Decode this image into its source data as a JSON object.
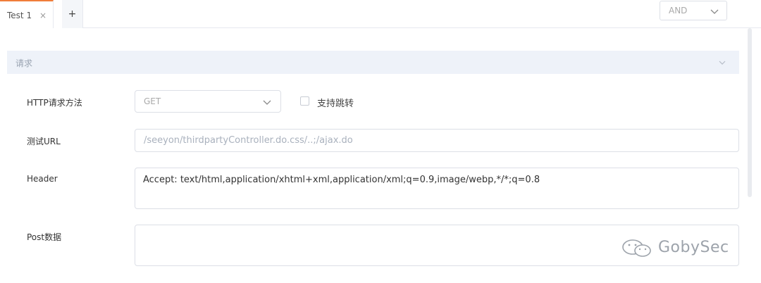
{
  "tabs": {
    "active_label": "Test 1",
    "close_glyph": "×",
    "add_glyph": "+"
  },
  "logic_select": {
    "value": "AND"
  },
  "section": {
    "title": "请求"
  },
  "form": {
    "method": {
      "label": "HTTP请求方法",
      "value": "GET"
    },
    "follow_redirect": {
      "label": "支持跳转",
      "checked": false
    },
    "url": {
      "label": "测试URL",
      "value": "/seeyon/thirdpartyController.do.css/..;/ajax.do"
    },
    "header": {
      "label": "Header",
      "value": "Accept: text/html,application/xhtml+xml,application/xml;q=0.9,image/webp,*/*;q=0.8"
    },
    "post_data": {
      "label": "Post数据",
      "value": ""
    }
  },
  "watermark": {
    "text": "GobySec"
  },
  "colors": {
    "accent": "#f07d3a",
    "section_bg": "#eef2f9",
    "border": "#dcdfe6"
  }
}
